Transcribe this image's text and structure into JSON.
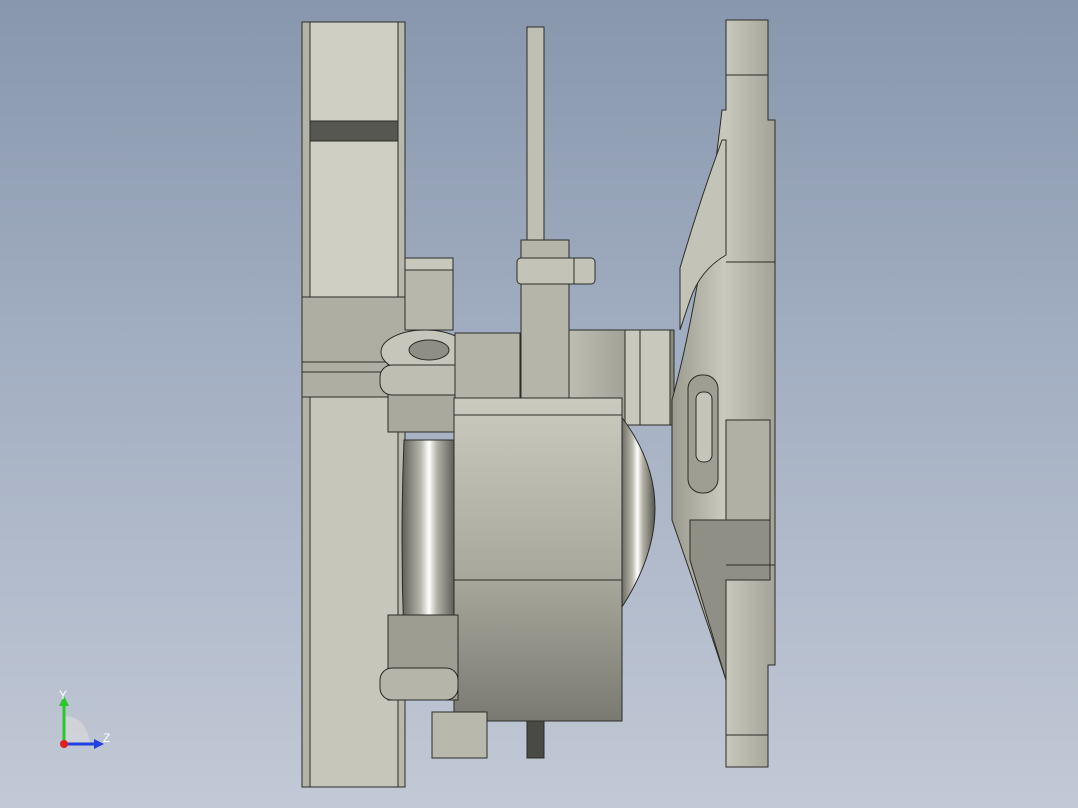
{
  "viewport": {
    "background_top": "#8897ad",
    "background_bottom": "#c2c9d6"
  },
  "model": {
    "description_icon": "cad-assembly-side-view",
    "part_color_light": "#d2d2c6",
    "part_color_mid": "#a9a99c",
    "part_color_dark": "#6f6f66",
    "edge_color": "#2c2c28"
  },
  "triad": {
    "y_label": "Y",
    "z_label": "Z",
    "y_color": "#28c828",
    "z_color": "#2040e0",
    "x_color": "#e02020"
  }
}
